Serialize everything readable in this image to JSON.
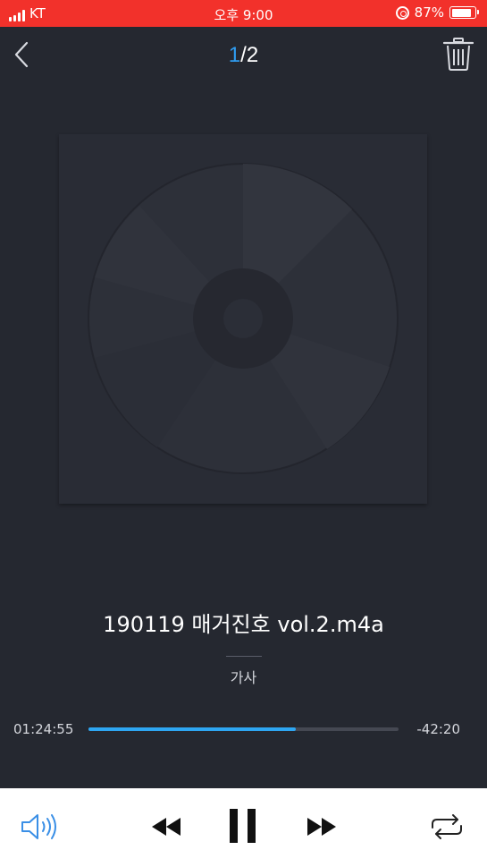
{
  "status_bar": {
    "carrier": "KT",
    "time": "오후 9:00",
    "battery_percent": "87%",
    "battery_level": 0.87,
    "icons": [
      "signal-icon",
      "orientation-lock-icon",
      "battery-icon"
    ]
  },
  "header": {
    "page_current": "1",
    "page_separator": "/",
    "page_total": "2",
    "icons": [
      "back-chevron-icon",
      "trash-icon"
    ]
  },
  "track": {
    "title": "190119 매거진호 vol.2.m4a",
    "lyrics_label": "가사",
    "artwork_icon": "cd-disc-icon"
  },
  "playback": {
    "elapsed": "01:24:55",
    "remaining": "-42:20",
    "progress": 0.67
  },
  "controls": {
    "icons": [
      "speaker-icon",
      "rewind-icon",
      "pause-icon",
      "fast-forward-icon",
      "repeat-icon"
    ]
  },
  "colors": {
    "status_bar": "#f2312b",
    "background": "#252830",
    "accent": "#2ea6f2",
    "controls_bar": "#ffffff"
  }
}
